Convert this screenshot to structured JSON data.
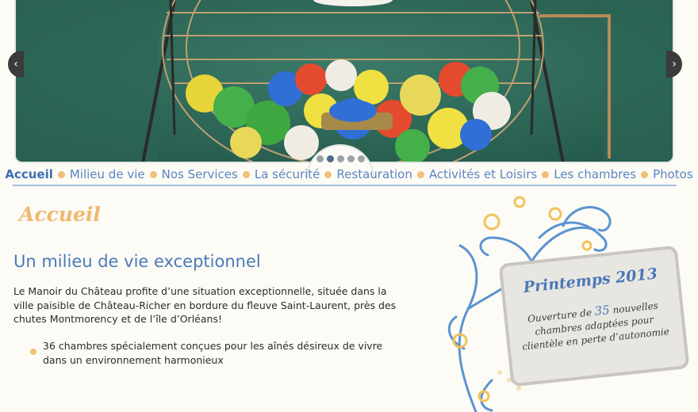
{
  "slider": {
    "prev_label": "‹",
    "next_label": "›",
    "dots": [
      {
        "active": false
      },
      {
        "active": true
      },
      {
        "active": false
      },
      {
        "active": false
      },
      {
        "active": false
      }
    ]
  },
  "nav": {
    "items": [
      {
        "label": "Accueil",
        "active": true
      },
      {
        "label": "Milieu de vie",
        "active": false
      },
      {
        "label": "Nos Services",
        "active": false
      },
      {
        "label": "La sécurité",
        "active": false
      },
      {
        "label": "Restauration",
        "active": false
      },
      {
        "label": "Activités et Loisirs",
        "active": false
      },
      {
        "label": "Les chambres",
        "active": false
      },
      {
        "label": "Photos",
        "active": false
      }
    ]
  },
  "main": {
    "section_title": "Accueil",
    "heading": "Un milieu de vie exceptionnel",
    "intro": "Le Manoir du Château profite d’une situation exceptionnelle, située dans la ville paisible de Château-Richer en bordure du fleuve Saint-Laurent, près des chutes Montmorency et de l’île d’Orléans!",
    "bullets": [
      "36 chambres spécialement conçues pour les aînés désireux de vivre dans un environnement harmonieux"
    ]
  },
  "promo": {
    "title": "Printemps 2013",
    "text_before": "Ouverture de ",
    "number": "35",
    "text_after": " nouvelles chambres adaptées pour clientèle en perte d’autonomie"
  },
  "colors": {
    "accent_blue": "#4a7ab8",
    "nav_blue": "#5b86c0",
    "bullet_orange": "#f1c078",
    "hero_green": "#2e6b5c"
  }
}
